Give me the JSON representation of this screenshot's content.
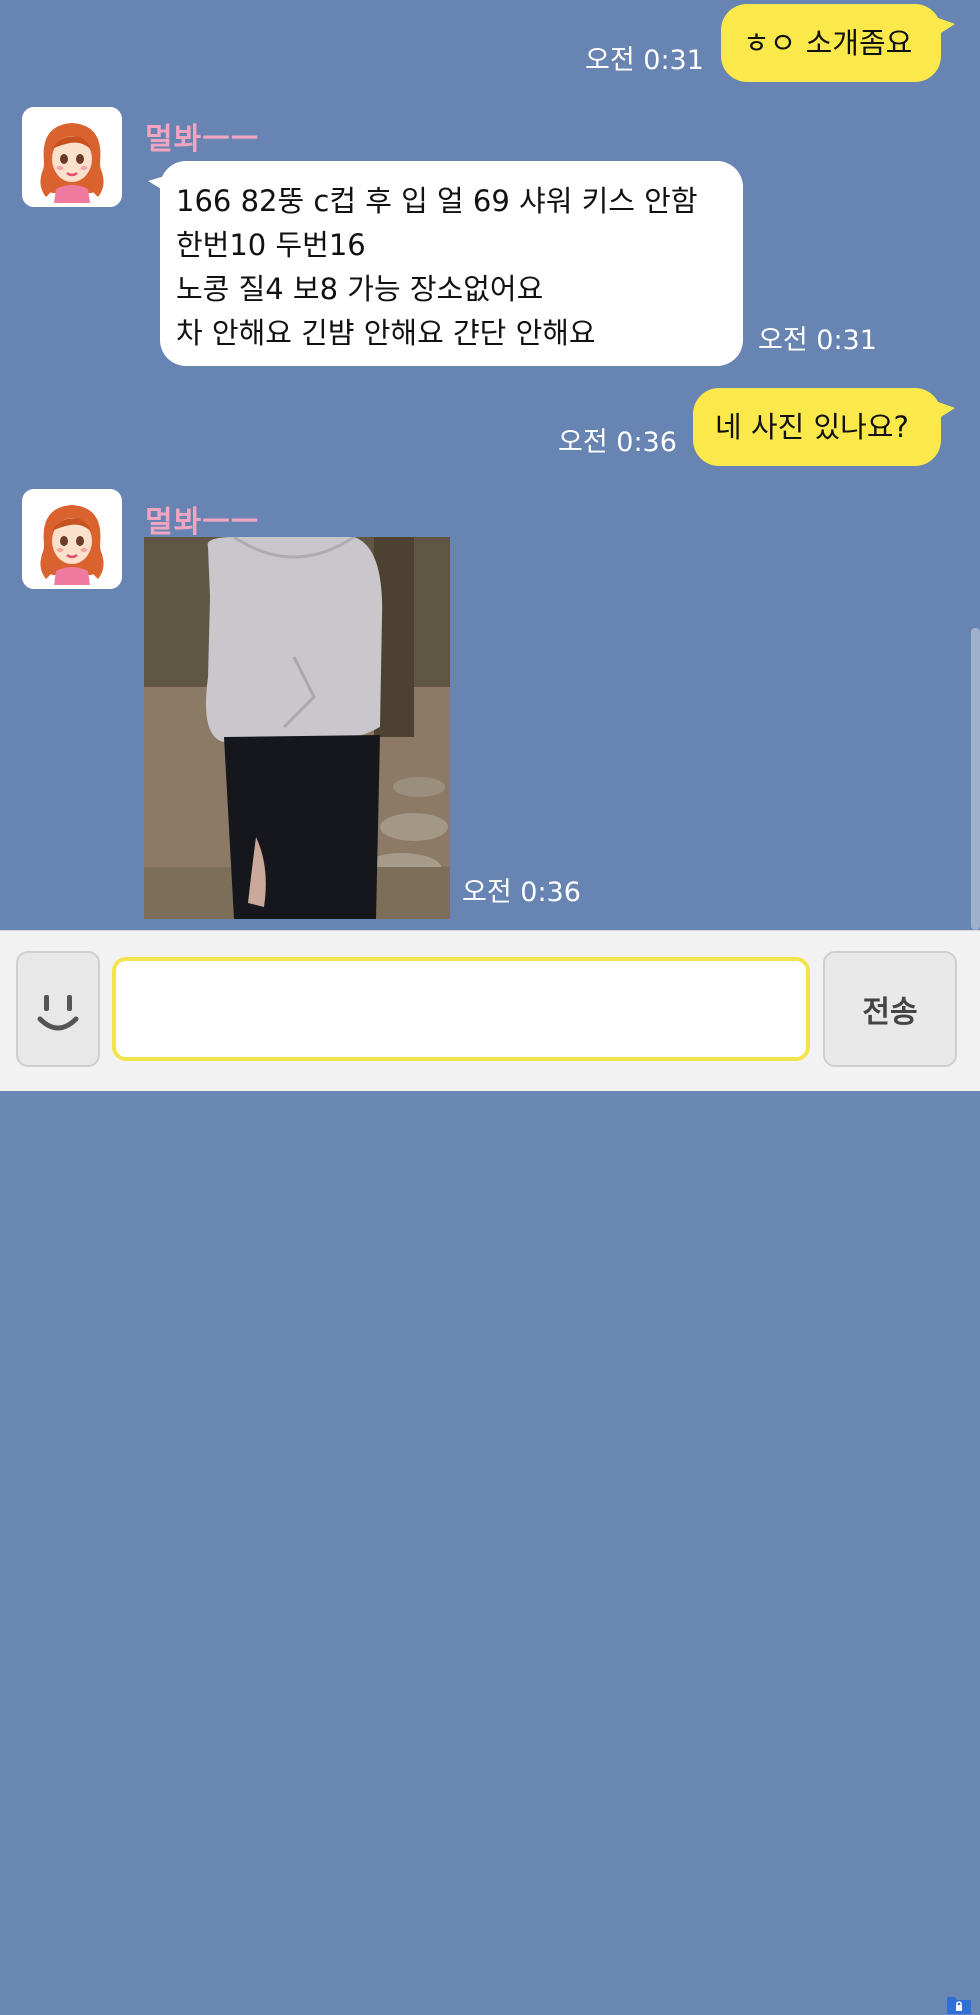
{
  "messages": [
    {
      "from": "me",
      "text": "ㅎㅇ 소개좀요",
      "time": "오전 0:31"
    },
    {
      "from": "them",
      "sender": "멀봐ㅡㅡ",
      "text": "166 82뚱 c컵 후 입 얼 69 샤워 키스 안함\n한번10 두번16\n노콩 질4 보8 가능 장소없어요\n차 안해요 긴뱜 안해요 갼단 안해요",
      "time": "오전 0:31"
    },
    {
      "from": "me",
      "text": "네 사진 있나요?",
      "time": "오전 0:36"
    },
    {
      "from": "them",
      "sender": "멀봐ㅡㅡ",
      "type": "photo",
      "time": "오전 0:36"
    }
  ],
  "input": {
    "placeholder": "",
    "value": ""
  },
  "send_label": "전송",
  "icons": {
    "emoji": "smiley-face-icon",
    "corner": "folder-lock-icon"
  },
  "colors": {
    "chat_background": "#6784b2",
    "my_bubble": "#fbe84b",
    "their_bubble": "#ffffff",
    "sender_name": "#f2a5c0",
    "input_border": "#f3e34d"
  }
}
